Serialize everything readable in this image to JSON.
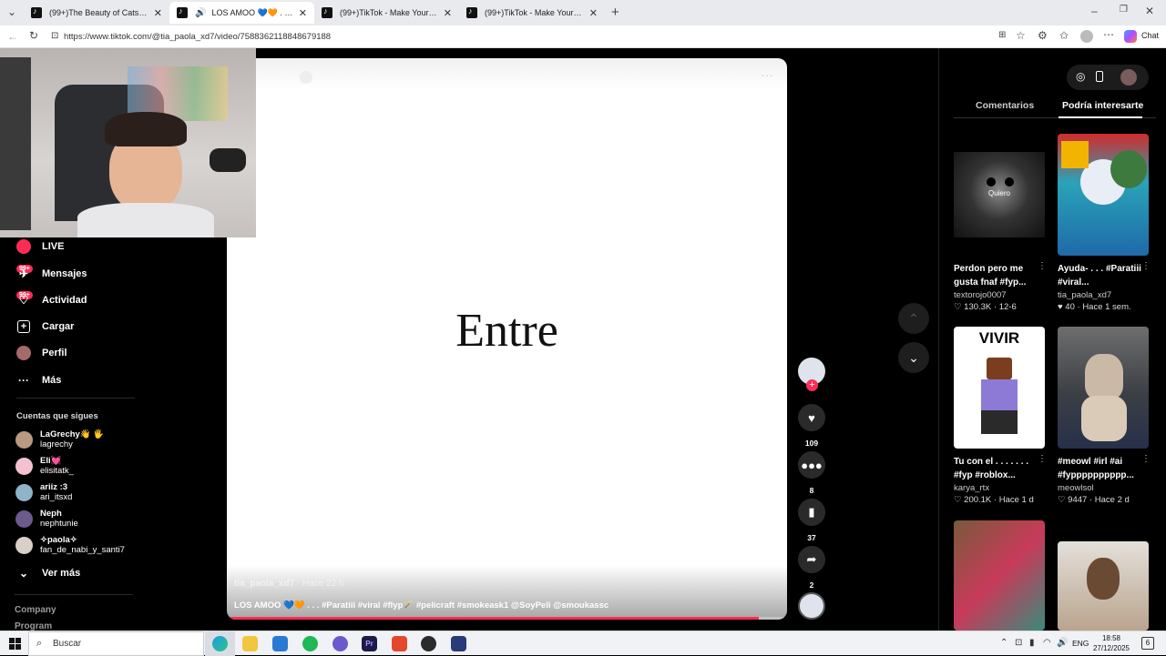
{
  "browser": {
    "tabs": [
      {
        "label": "(99+)The Beauty of Cats Under the...",
        "active": false
      },
      {
        "label": "LOS AMOO 💙🧡 . . . #Parati...",
        "active": true
      },
      {
        "label": "(99+)TikTok - Make Your Day",
        "active": false
      },
      {
        "label": "(99+)TikTok - Make Your Day",
        "active": false
      }
    ],
    "url": "https://www.tiktok.com/@tia_paola_xd7/video/7588362118848679188",
    "chat_label": "Chat"
  },
  "nav": {
    "items": [
      {
        "label": "LIVE",
        "icon": "live-icon"
      },
      {
        "label": "Mensajes",
        "icon": "messages-icon",
        "badge": "99+"
      },
      {
        "label": "Actividad",
        "icon": "activity-icon",
        "badge": "99+"
      },
      {
        "label": "Cargar",
        "icon": "upload-icon"
      },
      {
        "label": "Perfil",
        "icon": "profile-icon"
      },
      {
        "label": "Más",
        "icon": "more-icon"
      }
    ],
    "following_title": "Cuentas que sigues",
    "following": [
      {
        "name": "LaGrechy👋 🖐",
        "handle": "lagrechy"
      },
      {
        "name": "Eli💓",
        "handle": "elisitatk_"
      },
      {
        "name": "ariiz :3",
        "handle": "ari_itsxd"
      },
      {
        "name": "Neph",
        "handle": "nephtunie"
      },
      {
        "name": "✧paola✧",
        "handle": "fan_de_nabi_y_santi7"
      }
    ],
    "see_more": "Ver más",
    "footer": [
      "Company",
      "Program"
    ]
  },
  "video": {
    "word": "Entre",
    "author": "tia_paola_xd7",
    "time_ago": "Hace 22 h",
    "caption": "LOS AMOO 💙🧡 . . . #Paratiii #viral #flyp🪄 #pelicraft #smokeask1 @SoyPeli @smoukassc",
    "progress": 0.95
  },
  "actions": {
    "likes": "109",
    "comments": "8",
    "saves": "37",
    "shares": "2"
  },
  "panel": {
    "tabs": [
      "Comentarios",
      "Podría interesarte"
    ],
    "active_tab": "Podría interesarte",
    "cards": [
      {
        "title": "Perdon pero me gusta fnaf #fyp...",
        "author": "textorojo0007",
        "likes": "130.3K",
        "date": "12-6",
        "thumb_text": "Quiero"
      },
      {
        "title": "Ayuda- . . . #Paratiii #viral...",
        "author": "tia_paola_xd7",
        "likes": "40",
        "date": "Hace 1 sem."
      },
      {
        "title": "Tu con el . . . . . . . #fyp #roblox...",
        "author": "karya_rtx",
        "likes": "200.1K",
        "date": "Hace 1 d",
        "thumb_text": "VIVIR"
      },
      {
        "title": "#meowl #irl #ai #fypppppppppp...",
        "author": "meowlsol",
        "likes": "9447",
        "date": "Hace 2 d"
      }
    ]
  },
  "taskbar": {
    "search": "Buscar",
    "language": "ENG",
    "time": "18:58",
    "date": "27/12/2025",
    "notifications": "6"
  },
  "colors": {
    "accent": "#fe2c55",
    "background": "#000000"
  }
}
